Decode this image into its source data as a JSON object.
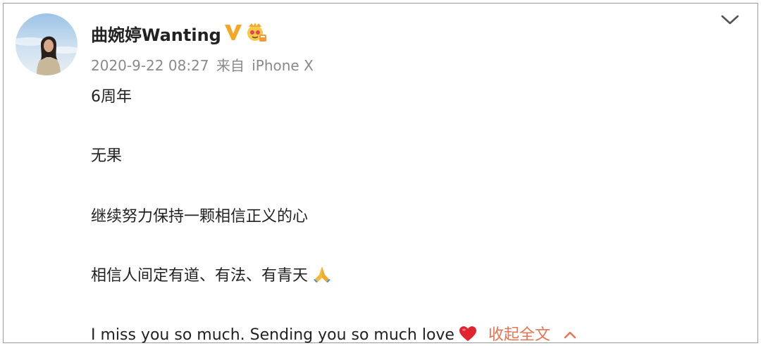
{
  "post": {
    "username": "曲婉婷Wanting",
    "timestamp": "2020-9-22 08:27",
    "source_prefix": "来自",
    "source_device": "iPhone X",
    "lines": [
      "6周年",
      "无果",
      "继续努力保持一颗相信正义的心",
      "相信人间定有道、有法、有青天",
      "I miss you so much. Sending you so much love"
    ],
    "collapse_label": "收起全文"
  },
  "icons": {
    "verified": "verified-v-icon",
    "member": "crown-member-icon",
    "menu": "chevron-down-icon",
    "pray": "folded-hands-emoji",
    "heart": "red-heart-emoji",
    "collapse": "chevron-up-icon"
  },
  "colors": {
    "accent": "#eb7350",
    "verified": "#f5a623",
    "meta_text": "#8a8a8a"
  }
}
